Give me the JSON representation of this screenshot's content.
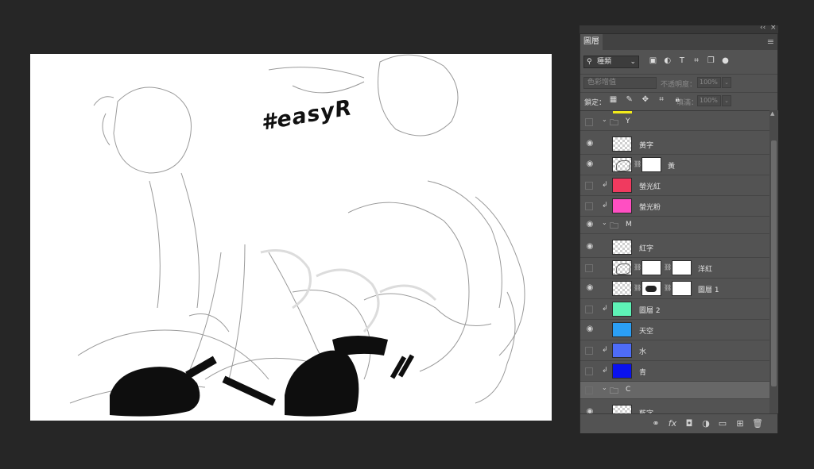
{
  "canvas": {
    "hashtag": "#easyR"
  },
  "panel": {
    "header_controls": {
      "collapse": "‹‹",
      "close": "×"
    },
    "tab_label": "圖層",
    "filter": {
      "kind": "種類"
    },
    "blend_mode": "色彩增值",
    "opacity_label": "不透明度：",
    "opacity_value": "100%",
    "lock_label": "鎖定：",
    "fill_label": "填滿：",
    "fill_value": "100%",
    "layers": [
      {
        "type": "group",
        "name": "Y",
        "visible": false
      },
      {
        "type": "layer",
        "name": "黃字",
        "visible": true,
        "clip": false,
        "thumb": "checker"
      },
      {
        "type": "layer",
        "name": "黃",
        "visible": true,
        "clip": false,
        "thumb": "sketch",
        "mask": "mask"
      },
      {
        "type": "layer",
        "name": "螢光紅",
        "visible": false,
        "clip": true,
        "color": "#f03a5f"
      },
      {
        "type": "layer",
        "name": "螢光粉",
        "visible": false,
        "clip": true,
        "color": "#ff4fc2"
      },
      {
        "type": "group",
        "name": "M",
        "visible": true
      },
      {
        "type": "layer",
        "name": "紅字",
        "visible": true,
        "clip": false,
        "thumb": "checker"
      },
      {
        "type": "layer",
        "name": "洋紅",
        "visible": false,
        "clip": false,
        "thumb": "sketch",
        "mask": "mask",
        "mask2": true
      },
      {
        "type": "layer",
        "name": "圖層 1",
        "visible": true,
        "clip": false,
        "thumb": "checker",
        "mask": "maskdark",
        "mask2": true
      },
      {
        "type": "layer",
        "name": "圖層 2",
        "visible": false,
        "clip": true,
        "color": "#5ef2b6"
      },
      {
        "type": "layer",
        "name": "天空",
        "visible": true,
        "clip": false,
        "color": "#2b9ff5"
      },
      {
        "type": "layer",
        "name": "水",
        "visible": false,
        "clip": true,
        "color": "#4e6cf7"
      },
      {
        "type": "layer",
        "name": "青",
        "visible": false,
        "clip": true,
        "color": "#0a12ee"
      },
      {
        "type": "group",
        "name": "C",
        "visible": false,
        "selected": true
      },
      {
        "type": "layer",
        "name": "藍字",
        "visible": true,
        "clip": false,
        "thumb": "checker"
      }
    ]
  }
}
